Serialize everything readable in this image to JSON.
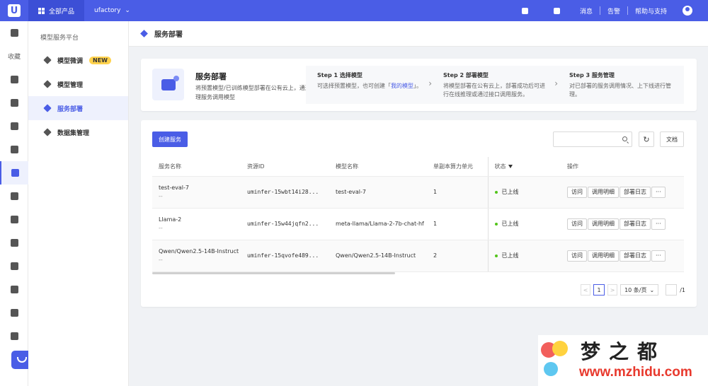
{
  "topbar": {
    "logo": "U",
    "all_products": "全部产品",
    "project": "ufactory",
    "messages": "消息",
    "alerts": "告警",
    "help": "帮助与支持"
  },
  "rail": {
    "favorites": "收藏"
  },
  "sidebar": {
    "title": "模型服务平台",
    "items": [
      {
        "label": "模型微调",
        "badge": "NEW"
      },
      {
        "label": "模型管理"
      },
      {
        "label": "服务部署"
      },
      {
        "label": "数据集管理"
      }
    ]
  },
  "page": {
    "title": "服务部署"
  },
  "intro": {
    "name": "服务部署",
    "desc": "将预置模型/已训练模型部署在公有云上，通过推理服务调用模型",
    "steps": [
      {
        "title": "Step 1 选择模型",
        "desc_pre": "可选择预置模型，也可创建「",
        "link": "我的模型",
        "desc_post": "」。"
      },
      {
        "title": "Step 2 部署模型",
        "desc": "将模型部署在公有云上，部署成功后可进行在线推理或通过接口调用服务。"
      },
      {
        "title": "Step 3 服务管理",
        "desc": "对已部署的服务调用情况、上下线进行管理。"
      }
    ]
  },
  "toolbar": {
    "create": "创建服务",
    "search_placeholder": "",
    "docs": "文档",
    "refresh_icon": "↻"
  },
  "table": {
    "columns": [
      "服务名称",
      "资源ID",
      "模型名称",
      "单副本算力单元",
      "状态",
      "操作"
    ],
    "rows": [
      {
        "name": "test-eval-7",
        "sub": "--",
        "id": "uminfer-15wbt14i28...",
        "model": "test-eval-7",
        "units": "1",
        "status": "已上线"
      },
      {
        "name": "Llama-2",
        "sub": "--",
        "id": "uminfer-15w44jqfn2...",
        "model": "meta-llama/Llama-2-7b-chat-hf",
        "units": "1",
        "status": "已上线"
      },
      {
        "name": "Qwen/Qwen2.5-14B-Instruct",
        "sub": "--",
        "id": "uminfer-15qvofe489...",
        "model": "Qwen/Qwen2.5-14B-Instruct",
        "units": "2",
        "status": "已上线"
      }
    ],
    "actions": [
      "访问",
      "调用明细",
      "部署日志",
      "···"
    ]
  },
  "pagination": {
    "prev": "<",
    "current": "1",
    "next": ">",
    "page_size": "10 条/页",
    "total": "/1"
  },
  "watermark": {
    "title": "梦之都",
    "url": "www.mzhidu.com"
  },
  "colors": {
    "primary": "#4a5de6",
    "status_online": "#52c41a"
  }
}
